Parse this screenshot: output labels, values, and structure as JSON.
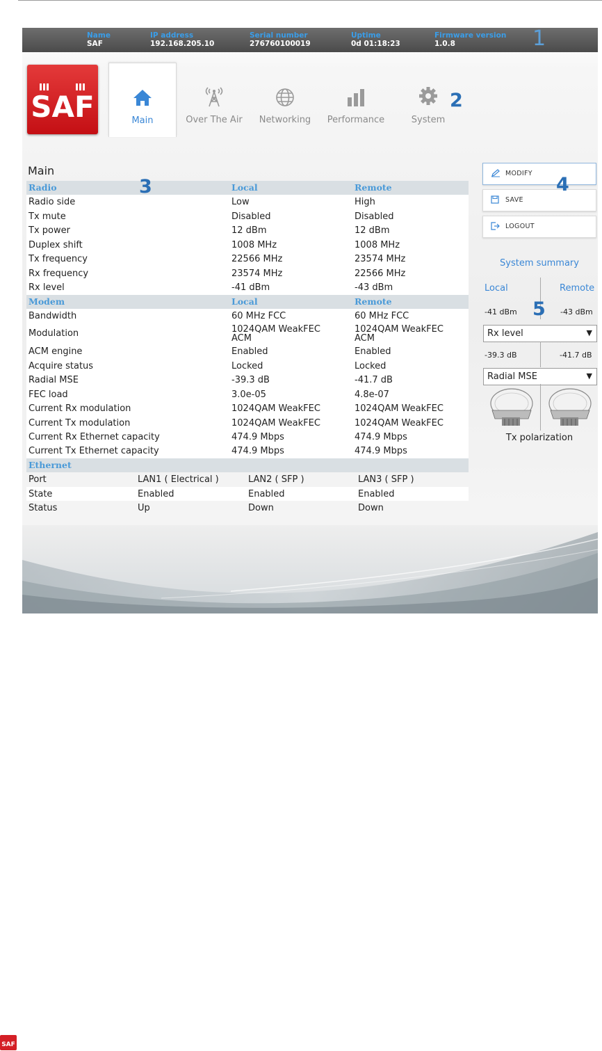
{
  "device_info": {
    "items": [
      {
        "label": "Name",
        "value": "SAF"
      },
      {
        "label": "IP address",
        "value": "192.168.205.10"
      },
      {
        "label": "Serial number",
        "value": "276760100019"
      },
      {
        "label": "Uptime",
        "value": "0d 01:18:23"
      },
      {
        "label": "Firmware version",
        "value": "1.0.8"
      }
    ]
  },
  "callouts": [
    "1",
    "2",
    "3",
    "4",
    "5"
  ],
  "logo": {
    "text": "SAF"
  },
  "nav": {
    "tabs": [
      {
        "label": "Main",
        "icon": "home-icon",
        "active": true
      },
      {
        "label": "Over The Air",
        "icon": "antenna-tower-icon",
        "active": false
      },
      {
        "label": "Networking",
        "icon": "globe-icon",
        "active": false
      },
      {
        "label": "Performance",
        "icon": "bar-chart-icon",
        "active": false
      },
      {
        "label": "System",
        "icon": "gear-icon",
        "active": false
      }
    ]
  },
  "main": {
    "title": "Main",
    "radio": {
      "header": [
        "Radio",
        "Local",
        "Remote"
      ],
      "rows": [
        [
          "Radio side",
          "Low",
          "High"
        ],
        [
          "Tx mute",
          "Disabled",
          "Disabled"
        ],
        [
          "Tx power",
          "12 dBm",
          "12 dBm"
        ],
        [
          "Duplex shift",
          "1008 MHz",
          "1008 MHz"
        ],
        [
          "Tx frequency",
          "22566 MHz",
          "23574 MHz"
        ],
        [
          "Rx frequency",
          "23574 MHz",
          "22566 MHz"
        ],
        [
          "Rx level",
          "-41 dBm",
          "-43 dBm"
        ]
      ]
    },
    "modem": {
      "header": [
        "Modem",
        "Local",
        "Remote"
      ],
      "rows": [
        [
          "Bandwidth",
          "60 MHz FCC",
          "60 MHz FCC"
        ],
        [
          "Modulation",
          "1024QAM WeakFEC ACM",
          "1024QAM WeakFEC ACM"
        ],
        [
          "ACM engine",
          "Enabled",
          "Enabled"
        ],
        [
          "Acquire status",
          "Locked",
          "Locked"
        ],
        [
          "Radial MSE",
          "-39.3 dB",
          "-41.7 dB"
        ],
        [
          "FEC load",
          "3.0e-05",
          "4.8e-07"
        ],
        [
          "Current Rx modulation",
          "1024QAM WeakFEC",
          "1024QAM WeakFEC"
        ],
        [
          "Current Tx modulation",
          "1024QAM WeakFEC",
          "1024QAM WeakFEC"
        ],
        [
          "Current Rx Ethernet capacity",
          "474.9 Mbps",
          "474.9 Mbps"
        ],
        [
          "Current Tx Ethernet capacity",
          "474.9 Mbps",
          "474.9 Mbps"
        ]
      ]
    },
    "ethernet": {
      "header": "Ethernet",
      "rows": [
        [
          "Port",
          "LAN1 ( Electrical )",
          "LAN2 ( SFP )",
          "LAN3 ( SFP )"
        ],
        [
          "State",
          "Enabled",
          "Enabled",
          "Enabled"
        ],
        [
          "Status",
          "Up",
          "Down",
          "Down"
        ]
      ]
    }
  },
  "actions": {
    "modify": "MODIFY",
    "save": "SAVE",
    "logout": "LOGOUT"
  },
  "summary": {
    "title": "System summary",
    "local_label": "Local",
    "remote_label": "Remote",
    "metric1": {
      "local": "-41 dBm",
      "remote": "-43 dBm",
      "selected": "Rx level"
    },
    "metric2": {
      "local": "-39.3 dB",
      "remote": "-41.7 dB",
      "selected": "Radial MSE"
    },
    "polarization_label": "Tx polarization"
  },
  "colors": {
    "accent_blue": "#3a87d6",
    "header_blue": "#4a9ad8",
    "logo_red": "#d41f26",
    "infobar_grey": "#5a5a5a"
  }
}
